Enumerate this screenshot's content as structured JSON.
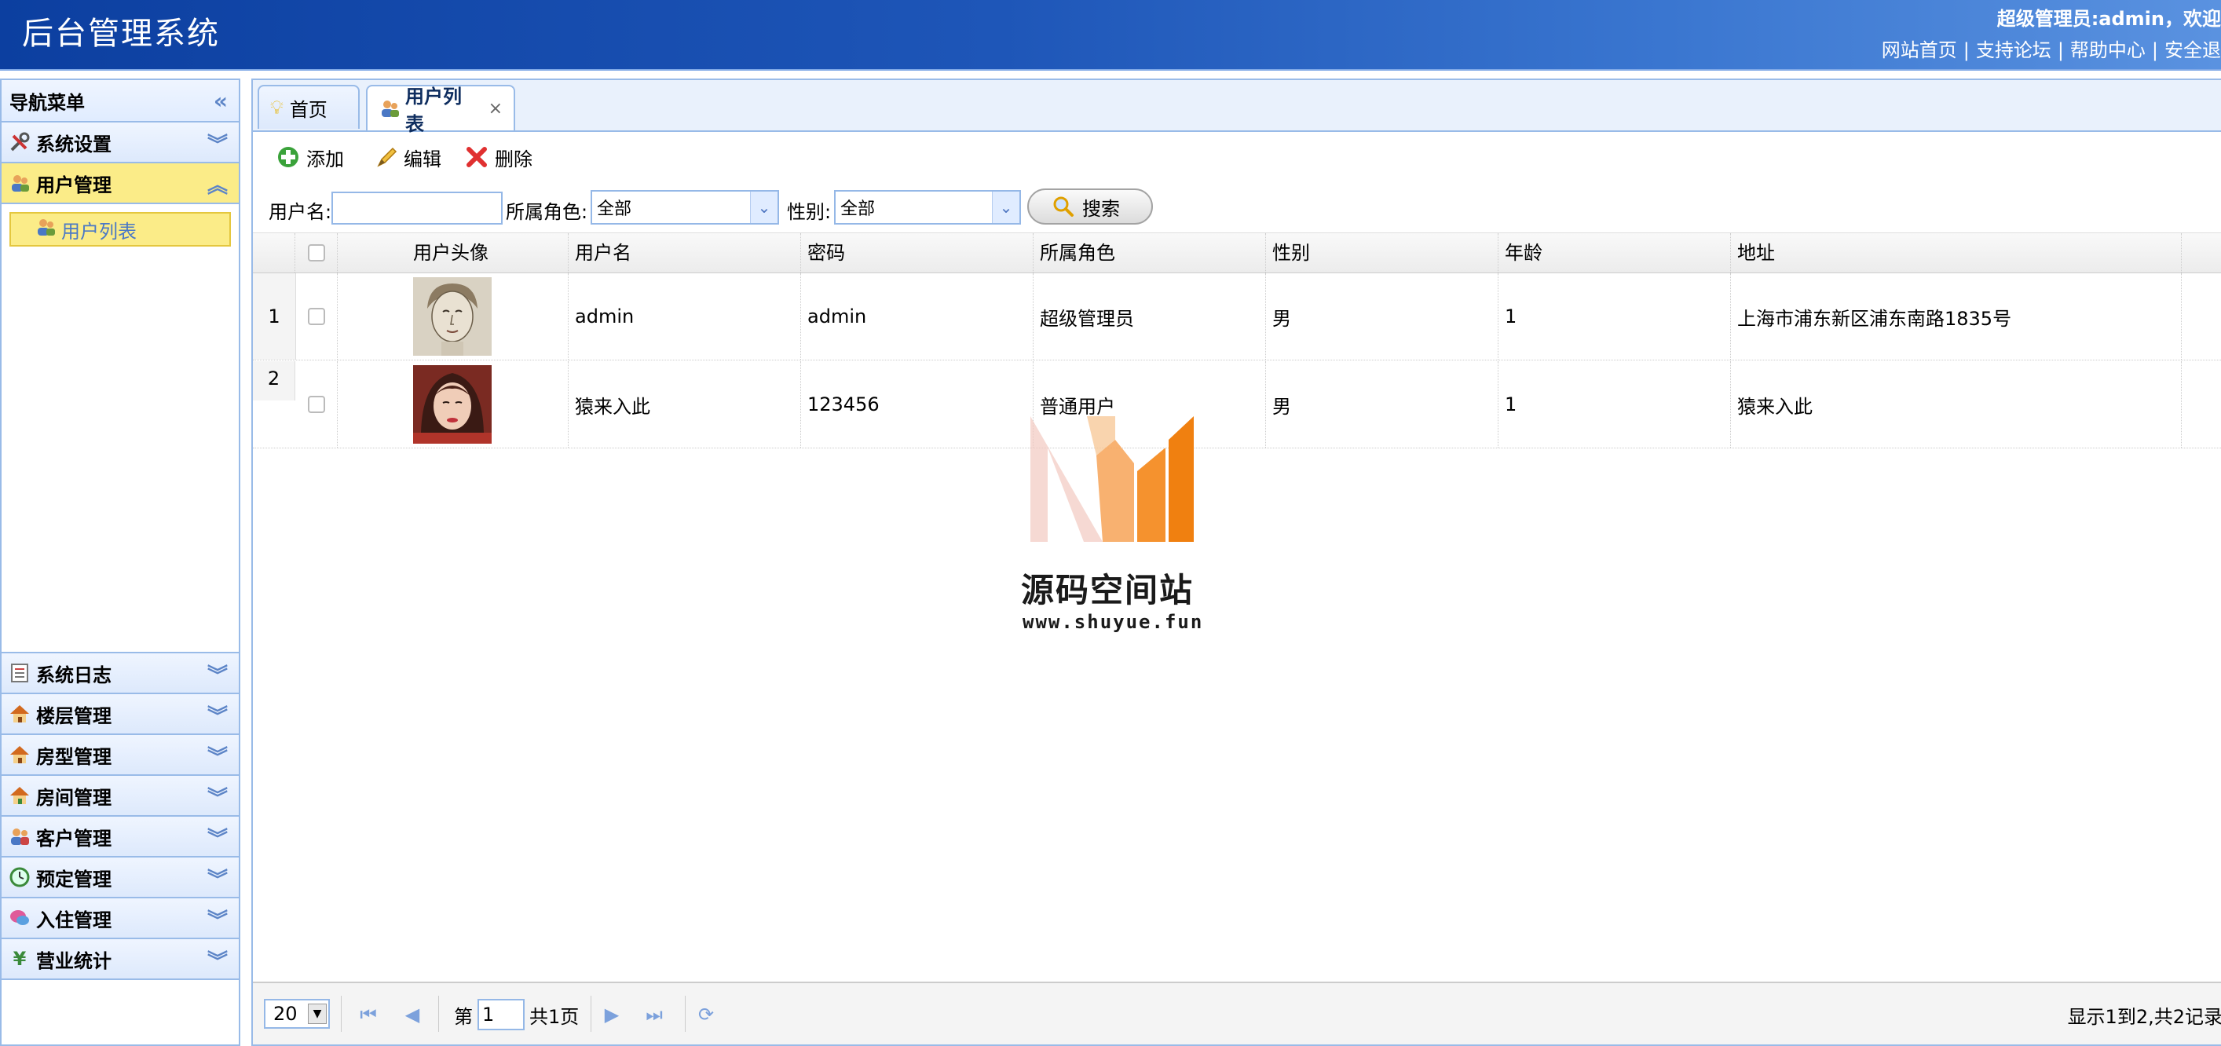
{
  "header": {
    "app_title": "后台管理系统",
    "welcome": "超级管理员:admin，欢迎",
    "links": [
      "网站首页",
      "支持论坛",
      "帮助中心",
      "安全退"
    ],
    "colors": {
      "bg_start": "#0c3fa0",
      "bg_end": "#5a92e0"
    }
  },
  "sidebar": {
    "title": "导航菜单",
    "panels_top": [
      {
        "label": "系统设置",
        "icon": "tools-icon"
      },
      {
        "label": "用户管理",
        "icon": "users-icon",
        "active": true
      }
    ],
    "sub_items": [
      {
        "label": "用户列表",
        "icon": "user-list-icon"
      }
    ],
    "panels_bottom": [
      {
        "label": "系统日志",
        "icon": "log-icon"
      },
      {
        "label": "楼层管理",
        "icon": "house-icon"
      },
      {
        "label": "房型管理",
        "icon": "house-icon"
      },
      {
        "label": "房间管理",
        "icon": "house-icon"
      },
      {
        "label": "客户管理",
        "icon": "customers-icon"
      },
      {
        "label": "预定管理",
        "icon": "clock-icon"
      },
      {
        "label": "入住管理",
        "icon": "checkin-icon"
      },
      {
        "label": "营业统计",
        "icon": "yen-icon"
      }
    ]
  },
  "tabs": [
    {
      "label": "首页",
      "icon": "bulb-icon"
    },
    {
      "label": "用户列表",
      "icon": "user-list-icon",
      "active": true,
      "close": "×"
    }
  ],
  "toolbar": {
    "add": "添加",
    "edit": "编辑",
    "delete": "删除"
  },
  "filters": {
    "username_label": "用户名:",
    "username_value": "",
    "role_label": "所属角色:",
    "role_value": "全部",
    "gender_label": "性别:",
    "gender_value": "全部",
    "search": "搜索"
  },
  "grid": {
    "columns": [
      "用户头像",
      "用户名",
      "密码",
      "所属角色",
      "性别",
      "年龄",
      "地址"
    ],
    "rows": [
      {
        "num": "1",
        "username": "admin",
        "password": "admin",
        "role": "超级管理员",
        "gender": "男",
        "age": "1",
        "address": "上海市浦东新区浦东南路1835号"
      },
      {
        "num": "2",
        "username": "猿来入此",
        "password": "123456",
        "role": "普通用户",
        "gender": "男",
        "age": "1",
        "address": "猿来入此"
      }
    ]
  },
  "pager": {
    "page_size": "20",
    "page_prefix": "第",
    "page_value": "1",
    "page_suffix": "共1页",
    "summary": "显示1到2,共2记录"
  },
  "watermark": {
    "title": "源码空间站",
    "url": "www.shuyue.fun"
  }
}
